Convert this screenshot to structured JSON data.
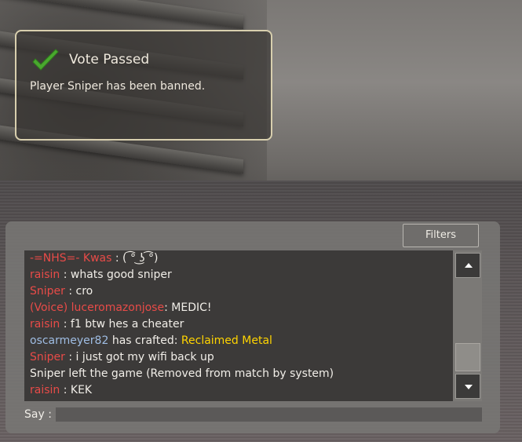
{
  "vote_panel": {
    "title": "Vote Passed",
    "message": "Player Sniper has been banned.",
    "icon": "checkmark-icon",
    "check_color": "#4aa82f"
  },
  "chat": {
    "filters_label": "Filters",
    "say_label": "Say :",
    "say_value": "",
    "lines": [
      {
        "name": "-=NHS=- Kwas",
        "sep": " : ",
        "text": " ( ͡° ͜ʖ ͡°)"
      },
      {
        "name": "raisin",
        "sep": " : ",
        "text": " whats good sniper"
      },
      {
        "name": "Sniper",
        "sep": " : ",
        "text": " cro"
      },
      {
        "name": "(Voice) luceromazonjose",
        "sep": ":",
        "text": " MEDIC!"
      },
      {
        "name": "raisin",
        "sep": " : ",
        "text": " f1 btw hes a cheater"
      },
      {
        "name": "oscarmeyer82",
        "action": " has crafted: ",
        "item": "Reclaimed Metal"
      },
      {
        "name": "Sniper",
        "sep": " : ",
        "text": " i just got my wifi back up"
      },
      {
        "text": "Sniper left the game (Removed from match by system)"
      },
      {
        "name": "raisin",
        "sep": " : ",
        "text": " KEK"
      }
    ],
    "colors": {
      "red_team": "#e84b48",
      "blue_team": "#9fbde3",
      "item_unique": "#ffd400",
      "text": "#f1eee8"
    }
  }
}
